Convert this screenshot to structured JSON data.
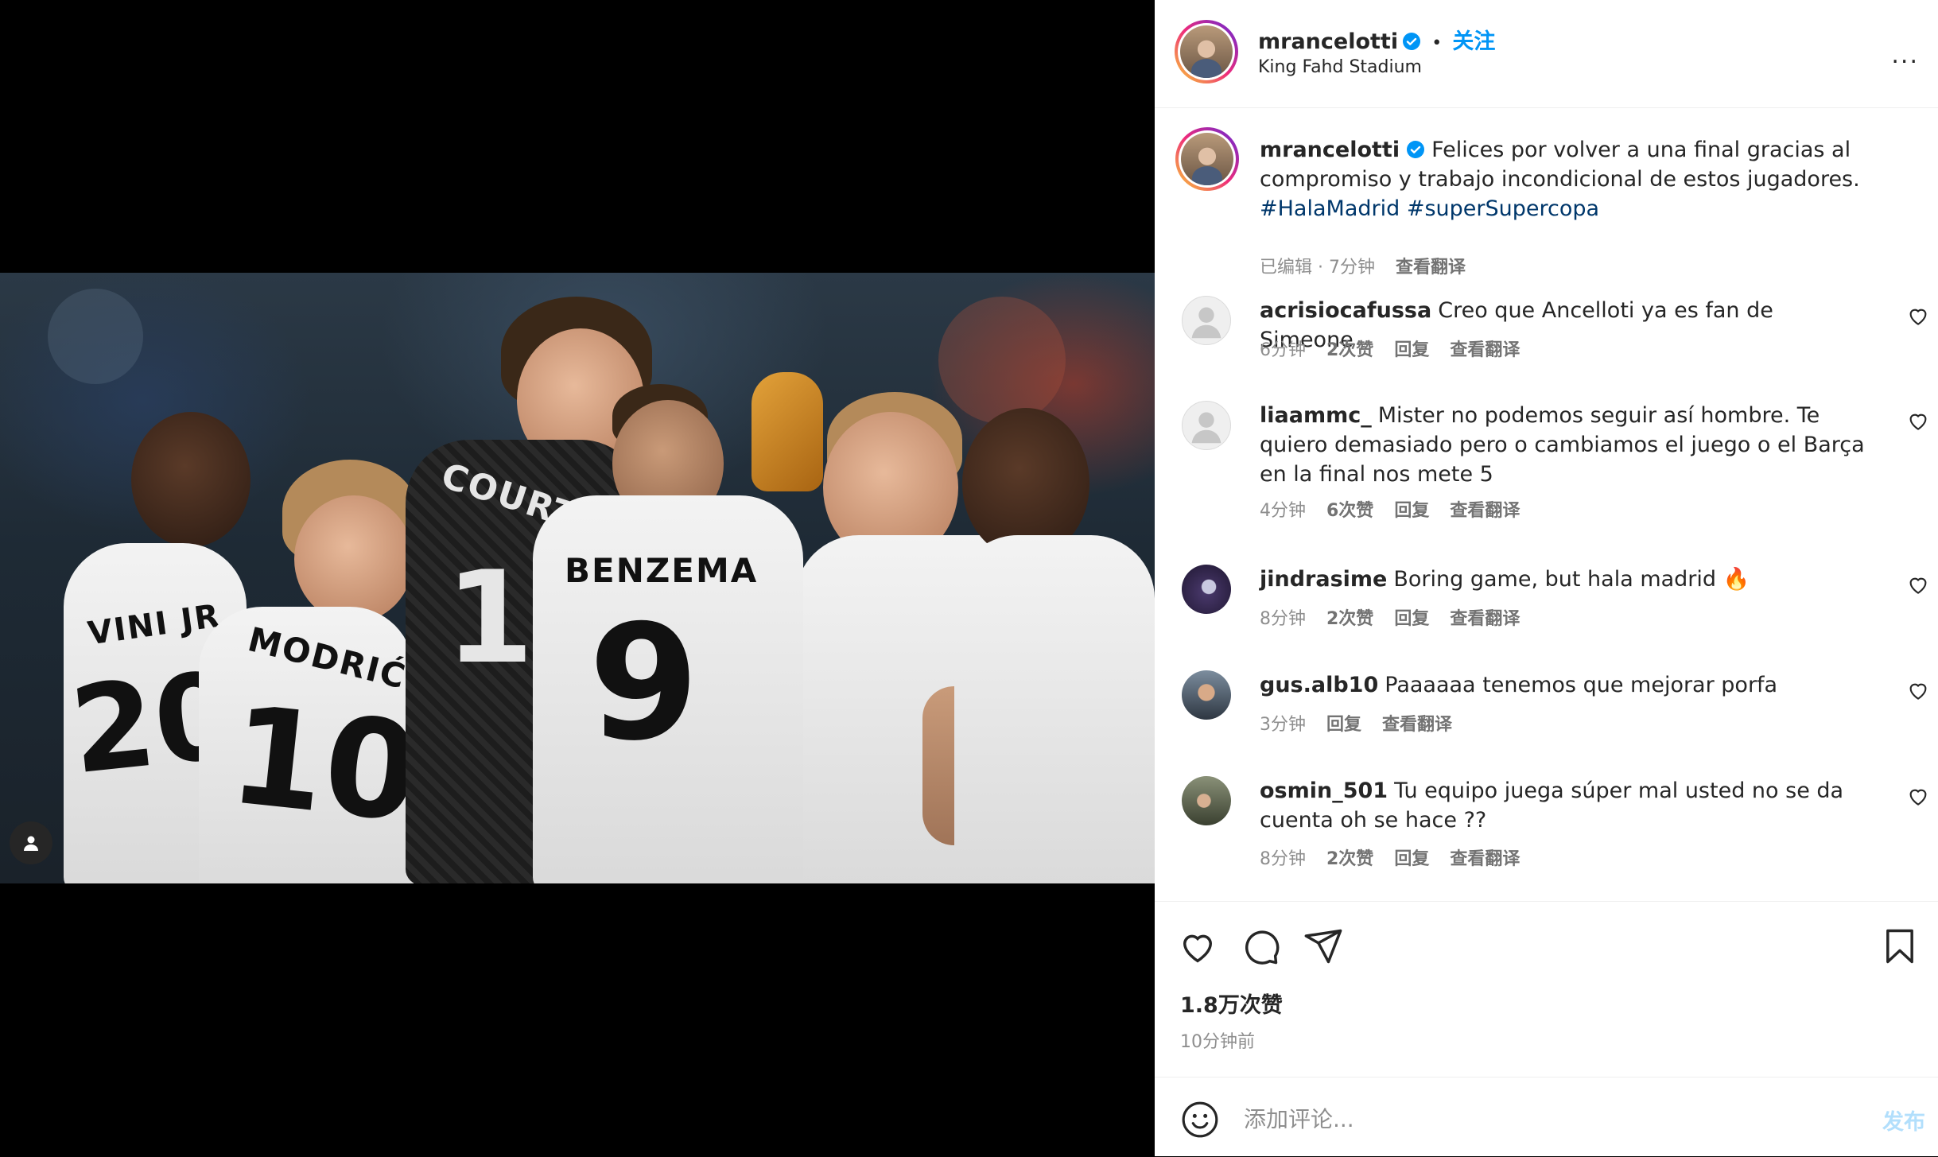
{
  "post": {
    "author": "mrancelotti",
    "follow_label": "关注",
    "separator": "•",
    "location": "King Fahd Stadium",
    "more_label": "...",
    "caption": "Felices por volver a una final gracias al compromiso y trabajo incondicional de estos jugadores.",
    "hashtags": [
      "#HalaMadrid",
      "#superSupercopa"
    ],
    "caption_meta": {
      "edited": "已编辑 · 7分钟",
      "translate": "查看翻译"
    },
    "image_jersey_names": [
      "COURTOIS",
      "BENZEMA",
      "MODRIĆ",
      "VINI JR"
    ],
    "image_jersey_numbers": [
      "1",
      "9",
      "10",
      "20"
    ]
  },
  "comments": [
    {
      "user": "acrisiocafussa",
      "text": "Creo que Ancelloti ya es fan de Simeone",
      "time": "6分钟",
      "likes": "2次赞",
      "reply": "回复",
      "translate": "查看翻译",
      "avatar": "default-avatar"
    },
    {
      "user": "liaammc_",
      "text": "Mister no podemos seguir así hombre. Te quiero demasiado pero o cambiamos el juego o el Barça en la final nos mete 5",
      "time": "4分钟",
      "likes": "6次赞",
      "reply": "回复",
      "translate": "查看翻译",
      "avatar": "default-avatar"
    },
    {
      "user": "jindrasime",
      "text": "Boring game, but hala madrid 🔥",
      "time": "8分钟",
      "likes": "2次赞",
      "reply": "回复",
      "translate": "查看翻译",
      "avatar": "photo-avatar"
    },
    {
      "user": "gus.alb10",
      "text": "Paaaaaa tenemos que mejorar porfa",
      "time": "3分钟",
      "likes": "",
      "reply": "回复",
      "translate": "查看翻译",
      "avatar": "photo-avatar"
    },
    {
      "user": "osmin_501",
      "text": "Tu equipo juega súper mal usted no se da cuenta oh se hace ??",
      "time": "8分钟",
      "likes": "2次赞",
      "reply": "回复",
      "translate": "查看翻译",
      "avatar": "photo-avatar"
    }
  ],
  "footer": {
    "like_count": "1.8万次赞",
    "posted_time": "10分钟前",
    "comment_placeholder": "添加评论...",
    "post_button": "发布"
  },
  "colors": {
    "accent": "#0095f6",
    "hashtag": "#00376b",
    "muted": "#8e8e8e",
    "post_disabled": "#b2dffc"
  },
  "icons": [
    "verified-badge-icon",
    "more-options-icon",
    "heart-icon",
    "comment-icon",
    "share-icon",
    "bookmark-icon",
    "emoji-icon",
    "user-tag-icon",
    "default-avatar-icon"
  ]
}
